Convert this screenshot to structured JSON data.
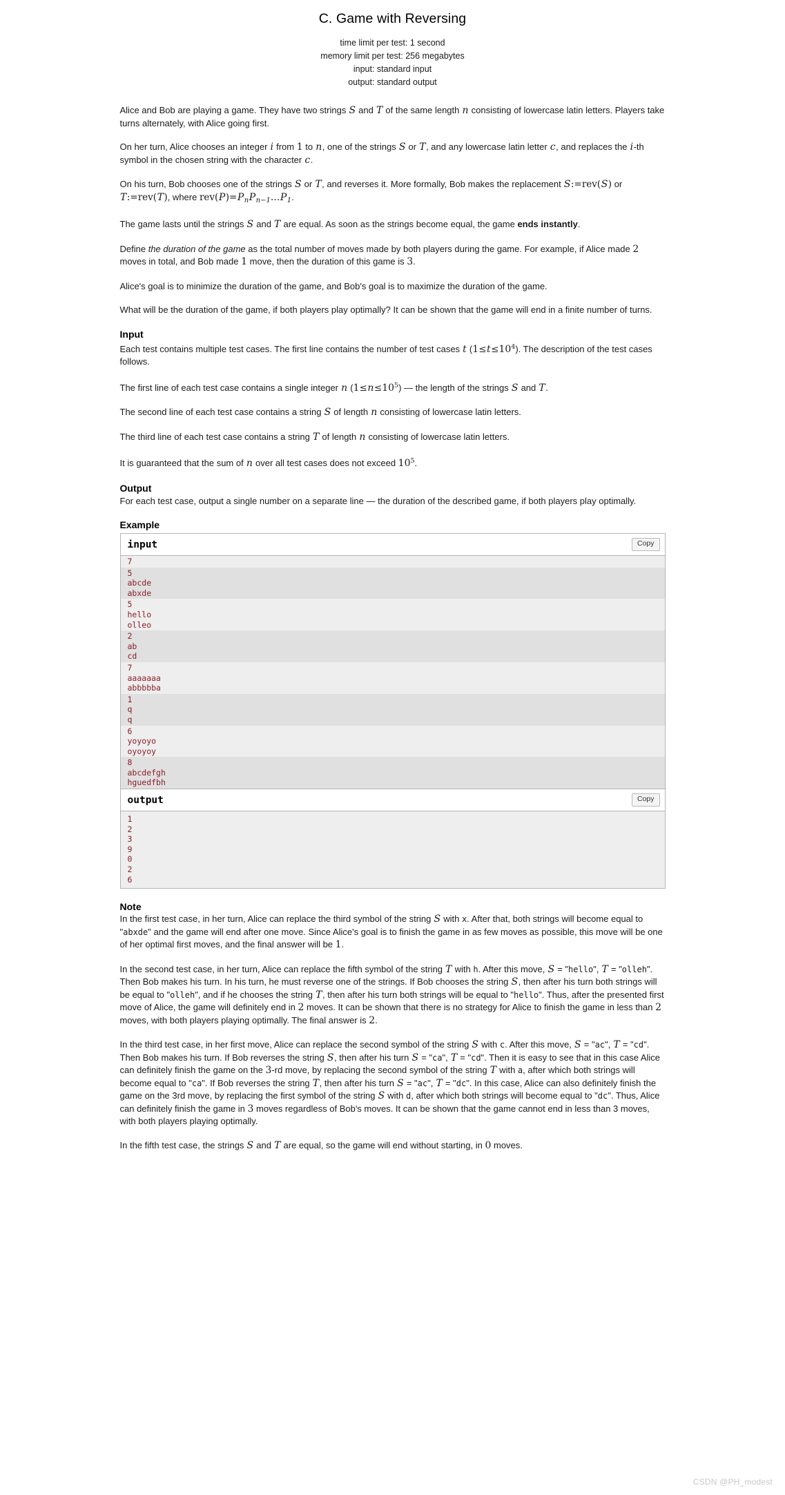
{
  "problem": {
    "title": "C. Game with Reversing",
    "limits": [
      "time limit per test: 1 second",
      "memory limit per test: 256 megabytes",
      "input: standard input",
      "output: standard output"
    ]
  },
  "sections": {
    "input_label": "Input",
    "output_label": "Output",
    "example_label": "Example",
    "note_label": "Note"
  },
  "statement": {
    "p1_a": "Alice and Bob are playing a game. They have two strings ",
    "p1_b": " and ",
    "p1_c": " of the same length ",
    "p1_d": " consisting of lowercase latin letters. Players take turns alternately, with Alice going first.",
    "p2_a": "On her turn, Alice chooses an integer ",
    "p2_b": " from ",
    "p2_c": " to ",
    "p2_d": ", one of the strings ",
    "p2_e": " or ",
    "p2_f": ", and any lowercase latin letter ",
    "p2_g": ", and replaces the ",
    "p2_h": "-th symbol in the chosen string with the character ",
    "p2_i": ".",
    "p3_a": "On his turn, Bob chooses one of the strings ",
    "p3_b": " or ",
    "p3_c": ", and reverses it. More formally, Bob makes the replacement ",
    "p3_d": " or ",
    "p3_e": ", where ",
    "p3_f": ".",
    "p4_a": "The game lasts until the strings ",
    "p4_b": " and ",
    "p4_c": " are equal. As soon as the strings become equal, the game ",
    "p4_bold": "ends instantly",
    "p4_d": ".",
    "p5_a": "Define ",
    "p5_em": "the duration of the game",
    "p5_b": " as the total number of moves made by both players during the game. For example, if Alice made ",
    "p5_c": " moves in total, and Bob made ",
    "p5_d": " move, then the duration of this game is ",
    "p5_e": ".",
    "p6": "Alice's goal is to minimize the duration of the game, and Bob's goal is to maximize the duration of the game.",
    "p7": "What will be the duration of the game, if both players play optimally? It can be shown that the game will end in a finite number of turns.",
    "in1_a": "Each test contains multiple test cases. The first line contains the number of test cases ",
    "in1_b": " (",
    "in1_c": "). The description of the test cases follows.",
    "in2_a": "The first line of each test case contains a single integer ",
    "in2_b": " (",
    "in2_c": ") — the length of the strings ",
    "in2_d": " and ",
    "in2_e": ".",
    "in3_a": "The second line of each test case contains a string ",
    "in3_b": " of length ",
    "in3_c": " consisting of lowercase latin letters.",
    "in4_a": "The third line of each test case contains a string ",
    "in4_b": " of length ",
    "in4_c": " consisting of lowercase latin letters.",
    "in5_a": "It is guaranteed that the sum of ",
    "in5_b": " over all test cases does not exceed ",
    "in5_c": ".",
    "out1": "For each test case, output a single number on a separate line — the duration of the described game, if both players play optimally."
  },
  "math": {
    "S": "S",
    "T": "T",
    "n": "n",
    "i": "i",
    "c": "c",
    "t": "t",
    "one": "1",
    "two": "2",
    "three": "3",
    "ten": "10",
    "exp4": "4",
    "exp5": "5",
    "rev": "rev",
    "P": "P",
    "sub_n": "n",
    "sub_nm1": "n−1",
    "sub_1": "1",
    "assign": ":=",
    "le": "≤",
    "eq": "=",
    "dots": "…"
  },
  "example": {
    "input_title": "input",
    "output_title": "output",
    "copy_label": "Copy",
    "input_cases": [
      [
        "7"
      ],
      [
        "5",
        "abcde",
        "abxde"
      ],
      [
        "5",
        "hello",
        "olleo"
      ],
      [
        "2",
        "ab",
        "cd"
      ],
      [
        "7",
        "aaaaaaa",
        "abbbbba"
      ],
      [
        "1",
        "q",
        "q"
      ],
      [
        "6",
        "yoyoyo",
        "oyoyoy"
      ],
      [
        "8",
        "abcdefgh",
        "hguedfbh"
      ]
    ],
    "output_lines": [
      "1",
      "2",
      "3",
      "9",
      "0",
      "2",
      "6"
    ]
  },
  "note": {
    "n1_a": "In the first test case, in her turn, Alice can replace the third symbol of the string ",
    "n1_b": " with ",
    "n1_code_x": "x",
    "n1_c": ". After that, both strings will become equal to \"",
    "n1_code_abxde": "abxde",
    "n1_d": "\" and the game will end after one move. Since Alice's goal is to finish the game in as few moves as possible, this move will be one of her optimal first moves, and the final answer will be ",
    "n1_e": ".",
    "n2_a": "In the second test case, in her turn, Alice can replace the fifth symbol of the string ",
    "n2_b": " with ",
    "n2_code_h": "h",
    "n2_c": ". After this move, ",
    "n2_d": " = \"",
    "n2_code_hello": "hello",
    "n2_e": "\", ",
    "n2_f": " = \"",
    "n2_code_olleh": "olleh",
    "n2_g": "\". Then Bob makes his turn. In his turn, he must reverse one of the strings. If Bob chooses the string ",
    "n2_h": ", then after his turn both strings will be equal to \"",
    "n2_code_olleh2": "olleh",
    "n2_i": "\", and if he chooses the string ",
    "n2_j": ", then after his turn both strings will be equal to \"",
    "n2_code_hello2": "hello",
    "n2_k": "\". Thus, after the presented first move of Alice, the game will definitely end in ",
    "n2_l": " moves. It can be shown that there is no strategy for Alice to finish the game in less than ",
    "n2_m": " moves, with both players playing optimally. The final answer is ",
    "n2_n": ".",
    "n3_a": "In the third test case, in her first move, Alice can replace the second symbol of the string ",
    "n3_b": " with ",
    "n3_code_c": "c",
    "n3_c": ". After this move, ",
    "n3_d": " = \"",
    "n3_code_ac": "ac",
    "n3_e": "\", ",
    "n3_f": " = \"",
    "n3_code_cd": "cd",
    "n3_g": "\". Then Bob makes his turn. If Bob reverses the string ",
    "n3_h": ", then after his turn ",
    "n3_i": " = \"",
    "n3_code_ca": "ca",
    "n3_j": "\", ",
    "n3_k": " = \"",
    "n3_code_cd2": "cd",
    "n3_l": "\". Then it is easy to see that in this case Alice can definitely finish the game on the ",
    "n3_m": "-rd move, by replacing the second symbol of the string ",
    "n3_n": " with ",
    "n3_code_a": "a",
    "n3_o": ", after which both strings will become equal to \"",
    "n3_code_ca2": "ca",
    "n3_p": "\". If Bob reverses the string ",
    "n3_q": ", then after his turn ",
    "n3_r": " = \"",
    "n3_code_ac2": "ac",
    "n3_s": "\", ",
    "n3_t": " = \"",
    "n3_code_dc": "dc",
    "n3_u": "\". In this case, Alice can also definitely finish the game on the 3rd move, by replacing the first symbol of the string ",
    "n3_v": " with ",
    "n3_code_d": "d",
    "n3_w": ", after which both strings will become equal to \"",
    "n3_code_dc2": "dc",
    "n3_x": "\". Thus, Alice can definitely finish the game in ",
    "n3_y": " moves regardless of Bob's moves. It can be shown that the game cannot end in less than 3 moves, with both players playing optimally.",
    "n5_a": "In the fifth test case, the strings ",
    "n5_b": " and ",
    "n5_c": " are equal, so the game will end without starting, in ",
    "n5_d": " moves.",
    "zero": "0"
  },
  "watermark": "CSDN @PH_modest",
  "colors": {
    "code_text": "#8a1c2b",
    "stripe_odd": "#eeeeee",
    "stripe_even": "#e0e0e0",
    "border": "#b5b5b5",
    "watermark": "#c8c8c8"
  }
}
